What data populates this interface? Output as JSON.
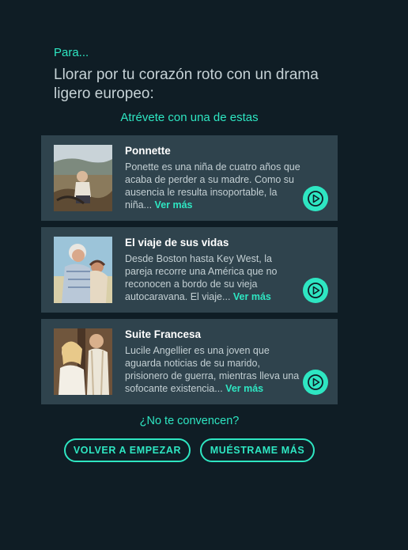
{
  "intro": {
    "para": "Para...",
    "heading": "Llorar por tu corazón roto con un drama ligero europeo:",
    "dare": "Atrévete con una de estas"
  },
  "movies": [
    {
      "title": "Ponnette",
      "description": "Ponette es una niña de cuatro años que acaba de perder a su madre. Como su ausencia le resulta insoportable, la niña...",
      "more": "Ver más"
    },
    {
      "title": "El viaje de sus vidas",
      "description": "Desde Boston hasta Key West, la pareja recorre una América que no reconocen a bordo de su vieja autocaravana. El viaje...",
      "more": "Ver más"
    },
    {
      "title": "Suite Francesa",
      "description": "Lucile Angellier es una joven que aguarda noticias de su marido, prisionero de guerra, mientras lleva una sofocante existencia...",
      "more": "Ver más"
    }
  ],
  "footer": {
    "question": "¿No te convencen?",
    "restart_label": "VOLVER A EMPEZAR",
    "more_label": "MUÉSTRAME MÁS"
  },
  "colors": {
    "background": "#0f1d25",
    "card": "#2f434d",
    "accent": "#2ee6c2"
  }
}
